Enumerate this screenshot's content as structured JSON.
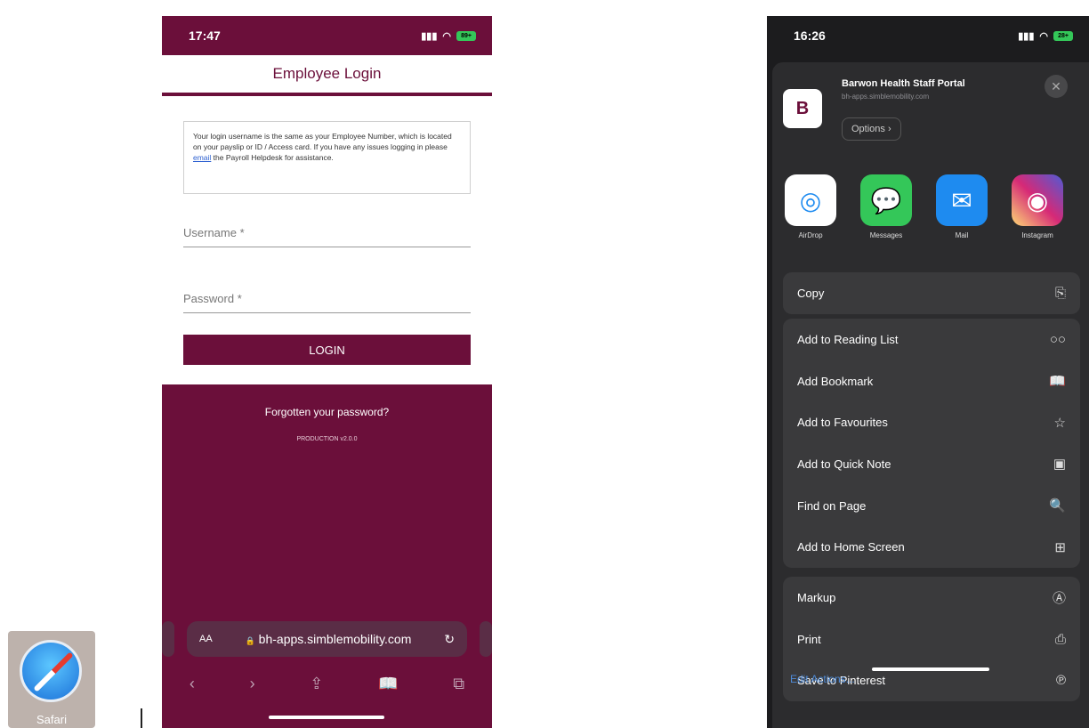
{
  "safari": {
    "label": "Safari"
  },
  "phone1": {
    "status": {
      "time": "17:47",
      "battery": "89+"
    },
    "title": "Employee Login",
    "info": {
      "before": "Your login username is the same as your Employee Number, which is located on your payslip or ID / Access card. If you have any issues logging in please ",
      "link": "email",
      "after": " the Payroll Helpdesk for assistance."
    },
    "username_placeholder": "Username *",
    "password_placeholder": "Password *",
    "login_label": "LOGIN",
    "forgot": "Forgotten your password?",
    "version": "PRODUCTION v2.0.0",
    "url": {
      "aa": "AA",
      "lock": "🔒",
      "text": "bh-apps.simblemobility.com",
      "reload": "↻"
    },
    "toolbar": {
      "back": "‹",
      "forward": "›",
      "share": "⇪",
      "bookmarks": "📖",
      "tabs": "⧉"
    }
  },
  "phone2": {
    "status": {
      "time": "16:26",
      "battery": "28+"
    },
    "app": {
      "name": "Barwon Health Staff Portal",
      "url": "bh-apps.simblemobility.com",
      "options": "Options ›",
      "icon": "B",
      "close": "✕"
    },
    "apps": [
      {
        "label": "AirDrop",
        "color": "#ffffff",
        "glyph": "◎",
        "icon": "airdrop-icon"
      },
      {
        "label": "Messages",
        "color": "#34c759",
        "glyph": "💬",
        "icon": "messages-icon"
      },
      {
        "label": "Mail",
        "color": "#1e8bf0",
        "glyph": "✉",
        "icon": "mail-icon"
      },
      {
        "label": "Instagram",
        "color": "#d62976",
        "glyph": "◉",
        "icon": "instagram-icon"
      }
    ],
    "copy": {
      "label": "Copy",
      "icon": "⎘"
    },
    "group2": [
      {
        "label": "Add to Reading List",
        "icon": "○○",
        "name": "reading-list-icon"
      },
      {
        "label": "Add Bookmark",
        "icon": "📖",
        "name": "bookmark-icon"
      },
      {
        "label": "Add to Favourites",
        "icon": "☆",
        "name": "star-icon"
      },
      {
        "label": "Add to Quick Note",
        "icon": "▣",
        "name": "quick-note-icon"
      },
      {
        "label": "Find on Page",
        "icon": "🔍",
        "name": "find-icon"
      },
      {
        "label": "Add to Home Screen",
        "icon": "⊞",
        "name": "add-square-icon"
      }
    ],
    "group3": [
      {
        "label": "Markup",
        "icon": "Ⓐ",
        "name": "markup-icon"
      },
      {
        "label": "Print",
        "icon": "⎙",
        "name": "print-icon"
      },
      {
        "label": "Save to Pinterest",
        "icon": "℗",
        "name": "pinterest-icon"
      }
    ],
    "edit": "Edit Actions..."
  }
}
